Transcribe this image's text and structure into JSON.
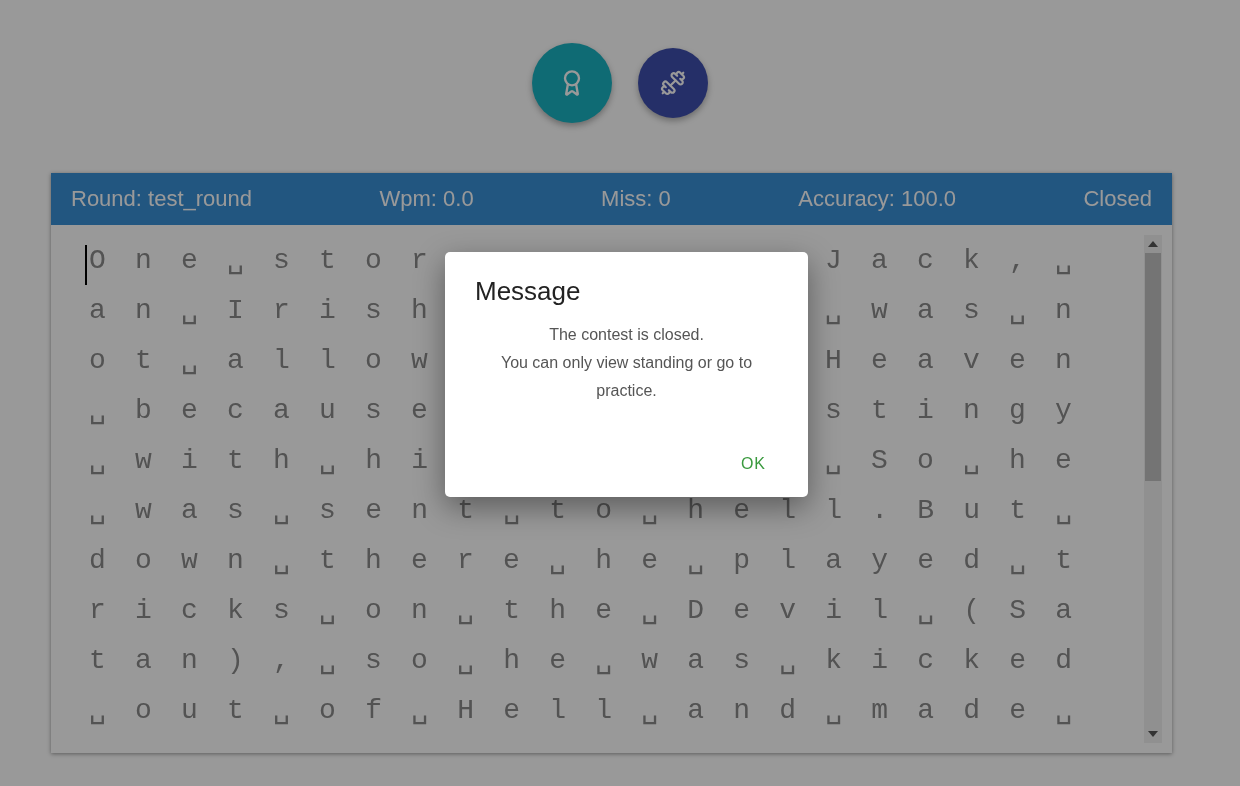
{
  "actions": [
    {
      "kind": "award"
    },
    {
      "kind": "practice"
    }
  ],
  "header": {
    "stats": [
      "Round: test_round",
      "Wpm: 0.0",
      "Miss: 0",
      "Accuracy: 100.0"
    ],
    "status": "Closed"
  },
  "typing": {
    "rows": [
      {
        "kind": "split",
        "left": "One␣stor",
        "right": "Jack,␣"
      },
      {
        "kind": "split",
        "left": "an␣Irish",
        "right": "␣was␣n"
      },
      {
        "kind": "split",
        "left": "ot␣allow",
        "right": "Heaven"
      },
      {
        "kind": "split",
        "left": "␣because",
        "right": "stingy"
      },
      {
        "kind": "split",
        "left": "␣with␣hi",
        "right": "␣So␣he"
      },
      {
        "kind": "full",
        "text": "␣was␣sent␣to␣hell.But␣"
      },
      {
        "kind": "full",
        "text": "down␣there␣he␣played␣t"
      },
      {
        "kind": "full",
        "text": "ricks␣on␣the␣Devil␣(Sa"
      },
      {
        "kind": "full",
        "text": "tan),␣so␣he␣was␣kicked"
      },
      {
        "kind": "full",
        "text": "␣out␣of␣Hell␣and␣made␣"
      }
    ]
  },
  "dialog": {
    "title": "Message",
    "lines": [
      "The contest is closed.",
      "You can only view standing or go to practice."
    ],
    "button": "OK"
  }
}
